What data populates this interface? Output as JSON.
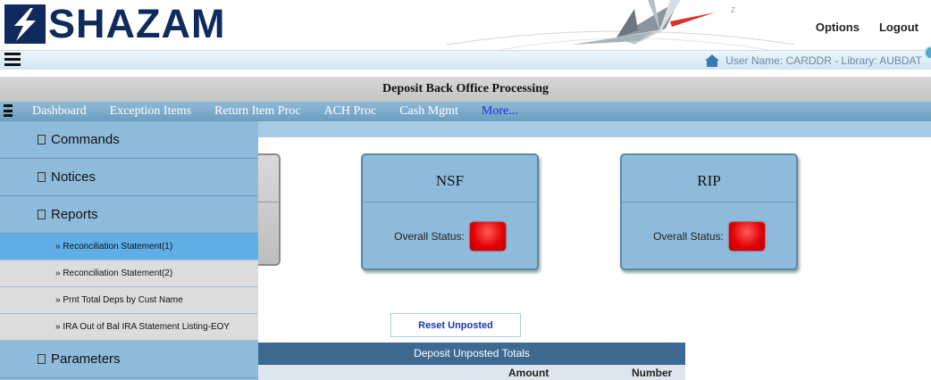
{
  "header": {
    "brand": "SHAZAM",
    "links": {
      "options": "Options",
      "logout": "Logout"
    }
  },
  "userbar": {
    "user_info": "User Name:  CARDDR  -  Library:  AUBDAT"
  },
  "title": "Deposit Back Office Processing",
  "nav": {
    "items": [
      {
        "label": "Dashboard"
      },
      {
        "label": "Exception Items"
      },
      {
        "label": "Return Item Proc"
      },
      {
        "label": "ACH Proc"
      },
      {
        "label": "Cash Mgmt"
      },
      {
        "label": "More..."
      }
    ]
  },
  "sidebar": {
    "sections": [
      {
        "label": "Commands"
      },
      {
        "label": "Notices"
      },
      {
        "label": "Reports"
      }
    ],
    "reports": [
      {
        "label": "» Reconciliation Statement(1)"
      },
      {
        "label": "» Reconciliation Statement(2)"
      },
      {
        "label": "» Prnt Total Deps by Cust Name"
      },
      {
        "label": "» IRA Out of Bal IRA Statement Listing-EOY"
      }
    ],
    "parameters": {
      "label": "Parameters"
    }
  },
  "cards": [
    {
      "title": "NSF",
      "status_label": "Overall Status:",
      "status_color": "#e00000"
    },
    {
      "title": "RIP",
      "status_label": "Overall Status:",
      "status_color": "#e00000"
    }
  ],
  "reset_button": "Reset Unposted",
  "totals": {
    "title": "Deposit Unposted Totals",
    "columns": [
      "Amount",
      "Number"
    ]
  },
  "colors": {
    "brand": "#0f2a5c",
    "nav_bar": "#7fb0d0",
    "sidebar": "#8fbbdb",
    "active_item": "#5faee8",
    "totals_header": "#3c6a91",
    "status_red": "#e00000"
  }
}
